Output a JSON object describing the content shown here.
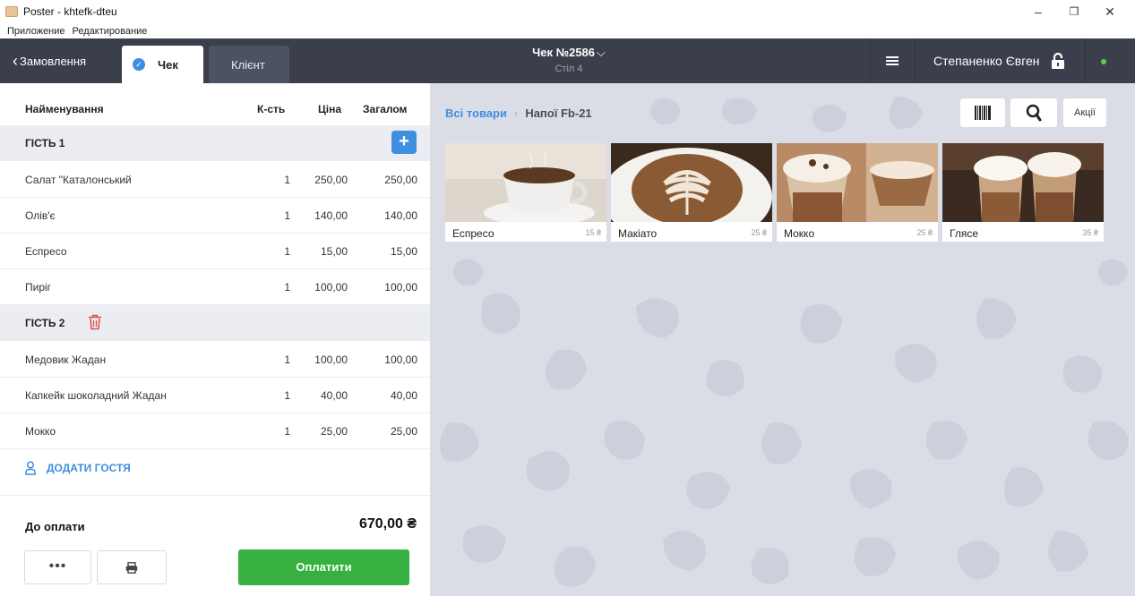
{
  "window": {
    "title": "Poster - khtefk-dteu",
    "minimize": "–",
    "restore": "❐",
    "close": "✕"
  },
  "menu": [
    "Приложение",
    "Редактирование"
  ],
  "header": {
    "back_label": "Замовлення",
    "tab_check": "Чек",
    "tab_client": "Клієнт",
    "receipt_title": "Чек №2586",
    "receipt_subtitle": "Стіл 4",
    "user_name": "Степаненко Євген",
    "status_color": "#5ad14b"
  },
  "order": {
    "columns": {
      "name": "Найменування",
      "qty": "К-сть",
      "price": "Ціна",
      "total": "Загалом"
    },
    "guests": [
      {
        "label": "ГІСТЬ 1",
        "items": [
          {
            "name": "Салат \"Каталонський",
            "qty": "1",
            "price": "250,00",
            "total": "250,00"
          },
          {
            "name": "Олів'є",
            "qty": "1",
            "price": "140,00",
            "total": "140,00"
          },
          {
            "name": "Еспресо",
            "qty": "1",
            "price": "15,00",
            "total": "15,00"
          },
          {
            "name": "Пиріг",
            "qty": "1",
            "price": "100,00",
            "total": "100,00"
          }
        ]
      },
      {
        "label": "ГІСТЬ 2",
        "items": [
          {
            "name": "Медовик Жадан",
            "qty": "1",
            "price": "100,00",
            "total": "100,00"
          },
          {
            "name": "Капкейк шоколадний Жадан",
            "qty": "1",
            "price": "40,00",
            "total": "40,00"
          },
          {
            "name": "Мокко",
            "qty": "1",
            "price": "25,00",
            "total": "25,00"
          }
        ]
      }
    ],
    "add_guest": "ДОДАТИ ГОСТЯ",
    "to_pay_label": "До оплати",
    "to_pay_total": "670,00 ₴",
    "more_label": "•••",
    "pay_button": "Оплатити"
  },
  "catalog": {
    "breadcrumb_all": "Всі товари",
    "breadcrumb_current": "Напої Fb-21",
    "promo_label": "Акції",
    "products": [
      {
        "name": "Еспресо",
        "price": "15 ₴"
      },
      {
        "name": "Макіато",
        "price": "25 ₴"
      },
      {
        "name": "Мокко",
        "price": "25 ₴"
      },
      {
        "name": "Глясе",
        "price": "35 ₴"
      }
    ]
  },
  "colors": {
    "accent": "#3d8fe0",
    "pay": "#36b141",
    "header": "#3a3f4b"
  }
}
